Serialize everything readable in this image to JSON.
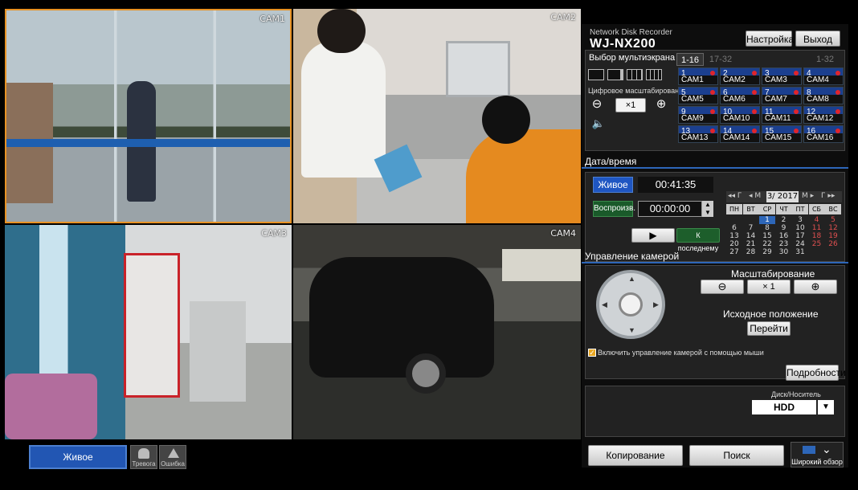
{
  "cameras": [
    {
      "label": "CAM1"
    },
    {
      "label": "CAM2"
    },
    {
      "label": "CAM3"
    },
    {
      "label": "CAM4"
    }
  ],
  "header": {
    "title": "Network Disk Recorder",
    "model": "WJ-NX200",
    "settings_label": "Настройка",
    "exit_label": "Выход"
  },
  "multiscreen": {
    "title": "Выбор мультиэкрана",
    "tabs": [
      "1-16",
      "17-32",
      "1-32"
    ],
    "digital_zoom_label": "Цифровое масштабирование",
    "zoom_value": "×1",
    "cams": [
      {
        "num": "1",
        "name": "CAM1"
      },
      {
        "num": "2",
        "name": "CAM2"
      },
      {
        "num": "3",
        "name": "CAM3"
      },
      {
        "num": "4",
        "name": "CAM4"
      },
      {
        "num": "5",
        "name": "CAM5"
      },
      {
        "num": "6",
        "name": "CAM6"
      },
      {
        "num": "7",
        "name": "CAM7"
      },
      {
        "num": "8",
        "name": "CAM8"
      },
      {
        "num": "9",
        "name": "CAM9"
      },
      {
        "num": "10",
        "name": "CAM10"
      },
      {
        "num": "11",
        "name": "CAM11"
      },
      {
        "num": "12",
        "name": "CAM12"
      },
      {
        "num": "13",
        "name": "CAM13"
      },
      {
        "num": "14",
        "name": "CAM14"
      },
      {
        "num": "15",
        "name": "CAM15"
      },
      {
        "num": "16",
        "name": "CAM16"
      }
    ]
  },
  "datetime": {
    "title": "Дата/время",
    "live_label": "Живое",
    "live_time": "00:41:35",
    "playback_label": "Воспроизв.",
    "playback_time": "00:00:00",
    "to_last_label": "К последнему",
    "calendar": {
      "month_label": "3/ 2017",
      "prev_year": "◂◂ Г",
      "prev_month": "◂ М",
      "next_month": "М ▸",
      "next_year": "Г ▸▸",
      "weekdays": [
        "ПН",
        "ВТ",
        "СР",
        "ЧТ",
        "ПТ",
        "СБ",
        "ВС"
      ],
      "days": [
        [
          "",
          "",
          "1",
          "2",
          "3",
          "4",
          "5"
        ],
        [
          "6",
          "7",
          "8",
          "9",
          "10",
          "11",
          "12"
        ],
        [
          "13",
          "14",
          "15",
          "16",
          "17",
          "18",
          "19"
        ],
        [
          "20",
          "21",
          "22",
          "23",
          "24",
          "25",
          "26"
        ],
        [
          "27",
          "28",
          "29",
          "30",
          "31",
          "",
          ""
        ]
      ],
      "selected_day": "1"
    }
  },
  "camera_control": {
    "title": "Управление камерой",
    "zoom_title": "Масштабирование",
    "zoom_value": "× 1",
    "home_title": "Исходное положение",
    "go_label": "Перейти",
    "mouse_control_label": "Включить управление камерой с помощью мыши",
    "mouse_control_checked": true,
    "details_label": "Подробности"
  },
  "disk": {
    "label": "Диск/Носитель",
    "value": "HDD"
  },
  "bottom": {
    "live_label": "Живое",
    "alarm_label": "Тревога",
    "error_label": "Ошибка",
    "copy_label": "Копирование",
    "search_label": "Поиск",
    "wide_view_label": "Широкий обзор"
  },
  "colors": {
    "accent_blue": "#2d66b8",
    "cam_cell_blue": "#1b3f8f",
    "red_dot": "#e0242c",
    "active_cam_border": "#e89224"
  }
}
